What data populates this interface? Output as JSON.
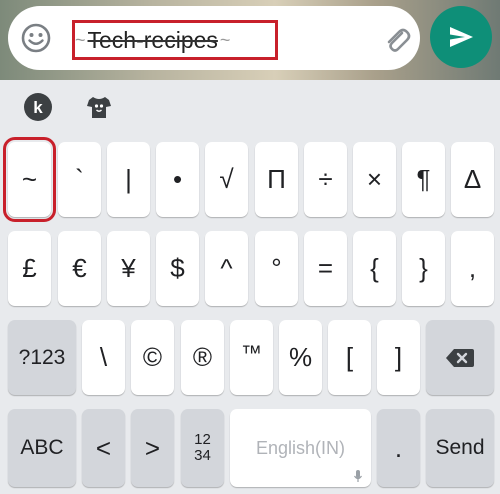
{
  "compose": {
    "message_text": "Tech-recipes",
    "tilde_left": "~",
    "tilde_right": "~"
  },
  "keyboard": {
    "toolbar": [
      "k-app-icon",
      "theme-shirt-icon"
    ],
    "row1": [
      "~",
      "`",
      "|",
      "•",
      "√",
      "Π",
      "÷",
      "×",
      "¶",
      "Δ"
    ],
    "row2": [
      "£",
      "€",
      "¥",
      "$",
      "^",
      "°",
      "=",
      "{",
      "}",
      ","
    ],
    "row3": {
      "mode_key": "?123",
      "keys": [
        "\\",
        "©",
        "®",
        "™",
        "%",
        "[",
        "]"
      ],
      "backspace_icon": "backspace-icon"
    },
    "row4": {
      "abc_key": "ABC",
      "less": "<",
      "greater": ">",
      "numpad_top": "12",
      "numpad_bottom": "34",
      "space_label": "English(IN)",
      "period": ".",
      "send_key": "Send"
    }
  },
  "colors": {
    "accent": "#0e8f78",
    "highlight": "#c8202b",
    "key_bg": "#ffffff",
    "func_key_bg": "#d3d6db",
    "keyboard_bg": "#e8eaed"
  }
}
